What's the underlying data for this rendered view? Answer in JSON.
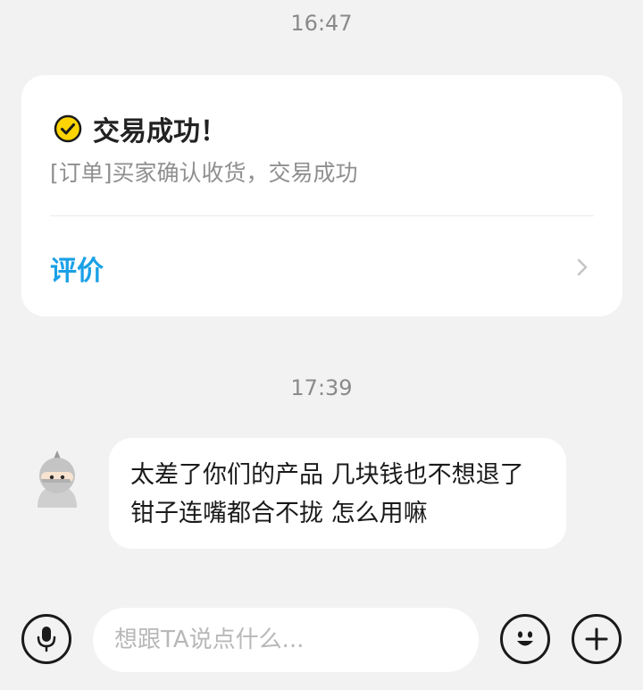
{
  "messages": {
    "timestamp1": "16:47",
    "timestamp2": "17:39"
  },
  "order_card": {
    "icon": "check-circle-icon",
    "title": "交易成功！",
    "subtitle": "[订单]买家确认收货，交易成功",
    "action_label": "评价",
    "action_icon": "chevron-right-icon"
  },
  "chat": {
    "sender_avatar": "ninja-avatar",
    "text": "太差了你们的产品 几块钱也不想退了 钳子连嘴都合不拢 怎么用嘛"
  },
  "input_bar": {
    "voice_icon": "microphone-icon",
    "placeholder": "想跟TA说点什么...",
    "emoji_icon": "smiley-icon",
    "more_icon": "plus-icon"
  },
  "colors": {
    "background": "#f2f2f2",
    "accent_blue": "#1aa0e6",
    "check_yellow": "#ffd400",
    "card": "#ffffff"
  }
}
